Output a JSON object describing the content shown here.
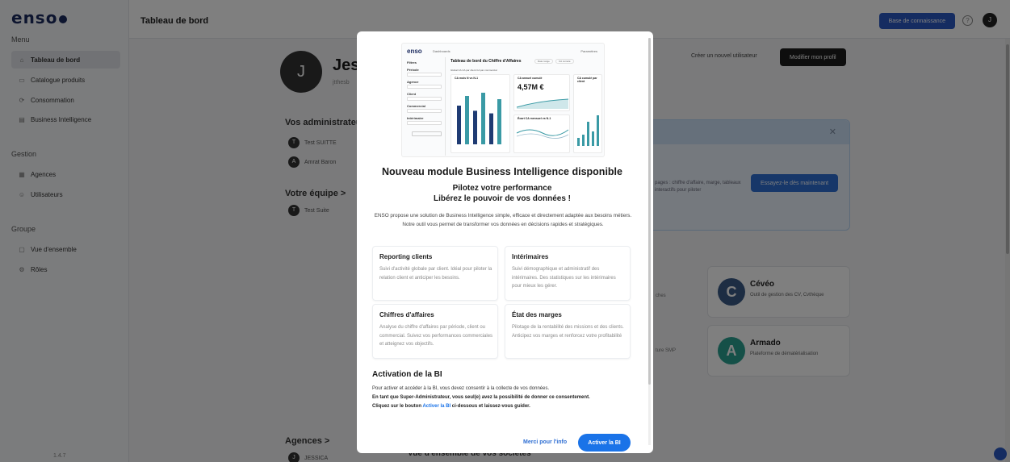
{
  "app": {
    "logo": "enso",
    "version": "1.4.7",
    "page_title": "Tableau de bord",
    "knowledge_base": "Base de connaissance",
    "help_icon": "question-circle-icon",
    "user_initial": "J"
  },
  "sidebar": {
    "menu_title": "Menu",
    "menu_items": [
      {
        "label": "Tableau de bord",
        "icon": "home-icon",
        "active": true
      },
      {
        "label": "Catalogue produits",
        "icon": "catalog-icon",
        "active": false
      },
      {
        "label": "Consommation",
        "icon": "consumption-icon",
        "active": false
      },
      {
        "label": "Business Intelligence",
        "icon": "chart-icon",
        "active": false
      }
    ],
    "gestion_title": "Gestion",
    "gestion_items": [
      {
        "label": "Agences",
        "icon": "building-icon"
      },
      {
        "label": "Utilisateurs",
        "icon": "users-icon"
      }
    ],
    "groupe_title": "Groupe",
    "groupe_items": [
      {
        "label": "Vue d'ensemble",
        "icon": "overview-icon"
      },
      {
        "label": "Rôles",
        "icon": "roles-icon"
      }
    ]
  },
  "profile": {
    "initial": "J",
    "name": "Jess",
    "email": "jtthesb",
    "create_user": "Créer un nouvel utilisateur",
    "edit_profile": "Modifier mon profil"
  },
  "admins": {
    "title": "Vos administrateurs",
    "people": [
      {
        "initial": "T",
        "name": "Test SUITTE"
      },
      {
        "initial": "A",
        "name": "Amrat Baron"
      }
    ]
  },
  "team": {
    "title": "Votre équipe >",
    "people": [
      {
        "initial": "T",
        "name": "Test Suite"
      }
    ]
  },
  "agencies": {
    "title": "Agences >",
    "people": [
      {
        "initial": "J",
        "name": "JESSICA"
      }
    ],
    "companies_title": "Vue d'ensemble de vos sociétés"
  },
  "banner": {
    "text": "pages : chiffre d'affaire, marge, tableaux interactifs pour piloter",
    "try_button": "Essayez-le dès maintenant",
    "close_icon": "close-icon"
  },
  "apps": [
    {
      "letter": "C",
      "name": "Cévéo",
      "desc": "Outil de gestion des CV, Cvthèque",
      "color": "#3b5b86"
    },
    {
      "letter": "A",
      "name": "Armado",
      "desc": "Plateforme de dématérialisation",
      "color": "#2aa191"
    }
  ],
  "fragments": {
    "left1": "ches",
    "left2": "ture SMP"
  },
  "modal": {
    "preview": {
      "logo": "enso",
      "menu": "Dashboards",
      "settings": "Paramètres",
      "title": "Tableau de bord du Chiffre d'Affaires",
      "chips": [
        "Date range",
        "CA cumulé"
      ],
      "filters_title": "Filtres",
      "filter_labels": [
        "Période",
        "Agence",
        "Client",
        "Commercial",
        "Intérimaire"
      ],
      "filter_button": "Appliquer les filtres",
      "tabs": "Global CA   CA par client   CA par commercial",
      "panel1_title": "CA mois N vs N-1",
      "panel2_title": "CA annuel cumulé",
      "panel2_value": "4,57M €",
      "panel3_title": "CA cumulé par client",
      "panel4_title": "Écart CA mensuel vs N-1",
      "panel1_bars": [
        60,
        75,
        52,
        80,
        48,
        70
      ],
      "panel3_bars": [
        10,
        14,
        30,
        18,
        38
      ]
    },
    "title": "Nouveau module Business Intelligence disponible",
    "subtitle1": "Pilotez votre performance",
    "subtitle2": "Libérez le pouvoir de vos données !",
    "description": "ENSO propose une solution de Business Intelligence simple, efficace et directement adaptée aux besoins métiers. Notre outil vous permet de transformer vos données en décisions rapides et stratégiques.",
    "features": [
      {
        "title": "Reporting clients",
        "desc": "Suivi d'activité globale par client. Idéal pour piloter la relation client et anticiper les besoins."
      },
      {
        "title": "Intérimaires",
        "desc": "Suivi démographique et administratif des intérimaires. Des statistiques sur les intérimaires pour mieux les gérer."
      },
      {
        "title": "Chiffres d'affaires",
        "desc": "Analyse du chiffre d'affaires par période, client ou commercial. Suivez vos performances commerciales et atteignez vos objectifs."
      },
      {
        "title": "État des marges",
        "desc": "Pilotage de la rentabilité des missions et des clients. Anticipez vos marges et renforcez votre profitabilité"
      }
    ],
    "activation_title": "Activation de la BI",
    "activation_line1": "Pour activer et accéder à la BI, vous devez consentir à la collecte de vos données.",
    "activation_line2": "En tant que Super-Administrateur, vous seul(e) avez la possibilité de donner ce consentement.",
    "activation_line3_a": "Cliquez sur le bouton ",
    "activation_line3_link": "Activer la BI",
    "activation_line3_b": " ci-dessous et laissez-vous guider.",
    "info_button": "Merci pour l'info",
    "activate_button": "Activer la BI"
  }
}
